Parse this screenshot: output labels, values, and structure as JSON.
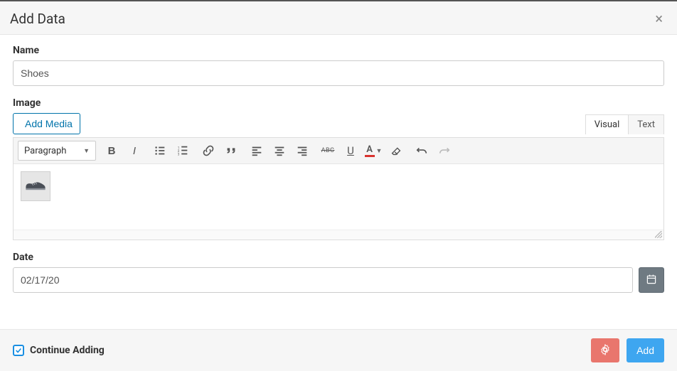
{
  "modal": {
    "title": "Add Data",
    "close_label": "×"
  },
  "fields": {
    "name": {
      "label": "Name",
      "value": "Shoes"
    },
    "image": {
      "label": "Image",
      "add_media_label": "Add Media",
      "tabs": {
        "visual": "Visual",
        "text": "Text"
      },
      "format_select": "Paragraph"
    },
    "date": {
      "label": "Date",
      "value": "02/17/20"
    }
  },
  "footer": {
    "continue_label": "Continue Adding",
    "continue_checked": true,
    "add_label": "Add"
  }
}
